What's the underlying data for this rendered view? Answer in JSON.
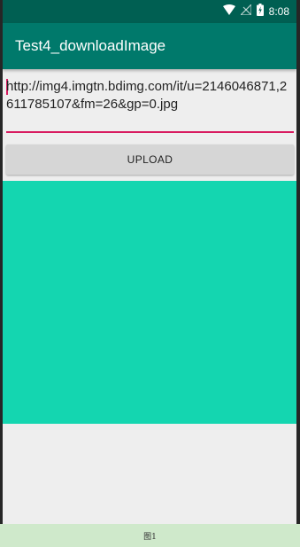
{
  "status_bar": {
    "time": "8:08",
    "icons": [
      "wifi-icon",
      "no-signal-icon",
      "battery-charging-icon"
    ]
  },
  "app_bar": {
    "title": "Test4_downloadImage"
  },
  "url_input": {
    "value": "http://img4.imgtn.bdimg.com/it/u=2146046871,2611785107&fm=26&gp=0.jpg"
  },
  "upload_button": {
    "label": "UPLOAD"
  },
  "image_view": {
    "color": "#14d6b0"
  },
  "caption": {
    "text": "图1"
  },
  "colors": {
    "status_bar": "#005f52",
    "app_bar": "#00796b",
    "accent": "#d81b60",
    "background": "#eeeeee"
  }
}
